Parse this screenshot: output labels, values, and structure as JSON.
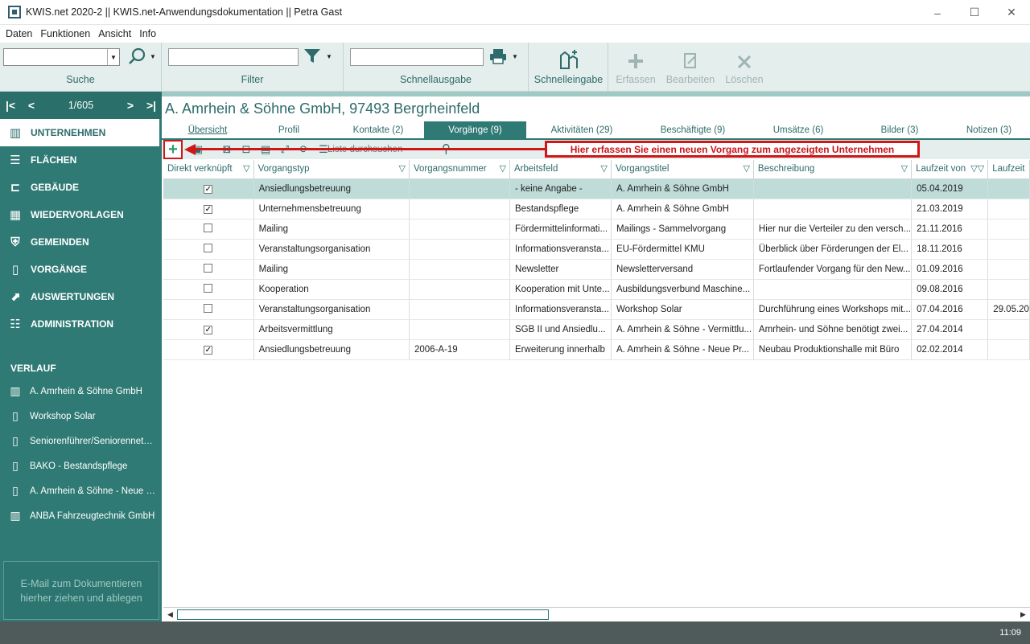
{
  "window": {
    "title": "KWIS.net 2020-2 || KWIS.net-Anwendungsdokumentation || Petra Gast",
    "minimize": "–",
    "maximize": "☐",
    "close": "✕"
  },
  "menu": [
    "Daten",
    "Funktionen",
    "Ansicht",
    "Info"
  ],
  "ribbon": {
    "search_label": "Suche",
    "filter_label": "Filter",
    "schnellausgabe_label": "Schnellausgabe",
    "schnelleingabe_label": "Schnelleingabe",
    "erfassen_label": "Erfassen",
    "bearbeiten_label": "Bearbeiten",
    "loeschen_label": "Löschen"
  },
  "pager": {
    "count": "1/605"
  },
  "nav": [
    {
      "label": "UNTERNEHMEN",
      "icon": "building-icon"
    },
    {
      "label": "FLÄCHEN",
      "icon": "area-icon"
    },
    {
      "label": "GEBÄUDE",
      "icon": "building-plan-icon"
    },
    {
      "label": "WIEDERVORLAGEN",
      "icon": "calendar-icon"
    },
    {
      "label": "GEMEINDEN",
      "icon": "shield-icon"
    },
    {
      "label": "VORGÄNGE",
      "icon": "folder-icon"
    },
    {
      "label": "AUSWERTUNGEN",
      "icon": "chart-icon"
    },
    {
      "label": "ADMINISTRATION",
      "icon": "settings-icon"
    }
  ],
  "history": {
    "heading": "VERLAUF",
    "items": [
      {
        "label": "A. Amrhein & Söhne GmbH",
        "icon": "building-icon"
      },
      {
        "label": "Workshop Solar",
        "icon": "folder-icon"
      },
      {
        "label": "Seniorenführer/Seniorennetzw...",
        "icon": "folder-icon"
      },
      {
        "label": "BÄKO - Bestandspflege",
        "icon": "folder-icon"
      },
      {
        "label": "A. Amrhein & Söhne - Neue Pr...",
        "icon": "folder-icon"
      },
      {
        "label": "ANBA Fahrzeugtechnik GmbH",
        "icon": "building-icon"
      }
    ]
  },
  "dropzone": {
    "line1": "E-Mail  zum Dokumentieren",
    "line2": "hierher ziehen und ablegen"
  },
  "record_title": "A. Amrhein & Söhne GmbH, 97493 Bergrheinfeld",
  "tabs": [
    {
      "label": "Übersicht"
    },
    {
      "label": "Profil"
    },
    {
      "label": "Kontakte (2)"
    },
    {
      "label": "Vorgänge (9)"
    },
    {
      "label": "Aktivitäten (29)"
    },
    {
      "label": "Beschäftigte (9)"
    },
    {
      "label": "Umsätze (6)"
    },
    {
      "label": "Bilder (3)"
    },
    {
      "label": "Notizen (3)"
    }
  ],
  "grid_toolbar": {
    "search_placeholder": "Liste durchsuchen"
  },
  "annotation": "Hier erfassen Sie einen neuen Vorgang zum angezeigten Unternehmen",
  "columns": [
    "Direkt verknüpft",
    "Vorgangstyp",
    "Vorgangsnummer",
    "Arbeitsfeld",
    "Vorgangstitel",
    "Beschreibung",
    "Laufzeit von",
    "Laufzeit"
  ],
  "rows": [
    {
      "checked": true,
      "typ": "Ansiedlungsbetreuung",
      "nummer": "",
      "feld": "- keine Angabe -",
      "titel": "A. Amrhein & Söhne GmbH",
      "beschreibung": "",
      "von": "05.04.2019",
      "bis": ""
    },
    {
      "checked": true,
      "typ": "Unternehmensbetreuung",
      "nummer": "",
      "feld": "Bestandspflege",
      "titel": "A. Amrhein & Söhne GmbH",
      "beschreibung": "",
      "von": "21.03.2019",
      "bis": ""
    },
    {
      "checked": false,
      "typ": "Mailing",
      "nummer": "",
      "feld": "Fördermittelinformati...",
      "titel": "Mailings - Sammelvorgang",
      "beschreibung": "Hier nur die Verteiler zu den versch...",
      "von": "21.11.2016",
      "bis": ""
    },
    {
      "checked": false,
      "typ": "Veranstaltungsorganisation",
      "nummer": "",
      "feld": "Informationsveransta...",
      "titel": "EU-Fördermittel KMU",
      "beschreibung": "Überblick über Förderungen der El...",
      "von": "18.11.2016",
      "bis": ""
    },
    {
      "checked": false,
      "typ": "Mailing",
      "nummer": "",
      "feld": "Newsletter",
      "titel": "Newsletterversand",
      "beschreibung": "Fortlaufender Vorgang für den New...",
      "von": "01.09.2016",
      "bis": ""
    },
    {
      "checked": false,
      "typ": "Kooperation",
      "nummer": "",
      "feld": "Kooperation mit Unte...",
      "titel": "Ausbildungsverbund Maschine...",
      "beschreibung": "",
      "von": "09.08.2016",
      "bis": ""
    },
    {
      "checked": false,
      "typ": "Veranstaltungsorganisation",
      "nummer": "",
      "feld": "Informationsveransta...",
      "titel": "Workshop Solar",
      "beschreibung": "Durchführung eines Workshops mit...",
      "von": "07.04.2016",
      "bis": "29.05.20"
    },
    {
      "checked": true,
      "typ": "Arbeitsvermittlung",
      "nummer": "",
      "feld": "SGB II und Ansiedlu...",
      "titel": "A. Amrhein & Söhne - Vermittlu...",
      "beschreibung": "Amrhein- und Söhne benötigt zwei...",
      "von": "27.04.2014",
      "bis": ""
    },
    {
      "checked": true,
      "typ": "Ansiedlungsbetreuung",
      "nummer": "2006-A-19",
      "feld": "Erweiterung innerhalb",
      "titel": "A. Amrhein & Söhne - Neue Pr...",
      "beschreibung": "Neubau Produktionshalle mit Büro",
      "von": "02.02.2014",
      "bis": ""
    }
  ],
  "status_time": "11:09",
  "colors": {
    "accent": "#2f7a74",
    "ribbon_bg": "#e4eeed",
    "selected_row": "#bfdcd9",
    "annotation": "#d01616"
  }
}
